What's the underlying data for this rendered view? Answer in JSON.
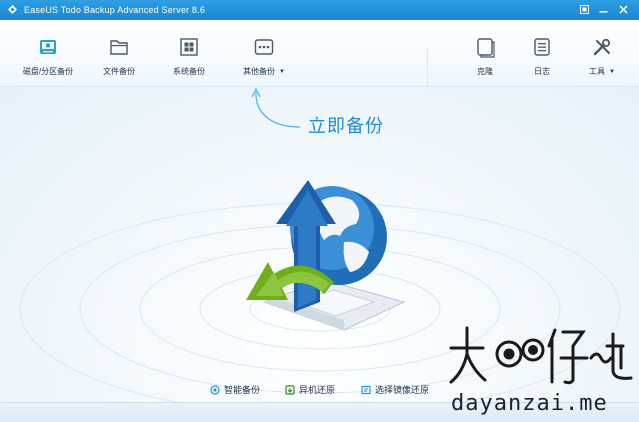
{
  "window": {
    "title": "EaseUS Todo Backup Advanced Server 8.6"
  },
  "toolbar": {
    "left_tools": [
      {
        "label": "磁盘/分区备份",
        "icon": "disk-partition-icon"
      },
      {
        "label": "文件备份",
        "icon": "folder-icon"
      },
      {
        "label": "系统备份",
        "icon": "windows-system-icon"
      },
      {
        "label": "其他备份",
        "icon": "more-dots-icon",
        "has_dropdown": true
      }
    ],
    "right_tools": [
      {
        "label": "克隆",
        "icon": "clone-icon"
      },
      {
        "label": "日志",
        "icon": "log-icon"
      },
      {
        "label": "工具",
        "icon": "tools-icon",
        "has_dropdown": true
      }
    ]
  },
  "main": {
    "backup_now_label": "立即备份",
    "hero_icon": "globe-backup-arrows-icon"
  },
  "bottom_actions": [
    {
      "label": "智能备份",
      "icon": "smart-backup-icon"
    },
    {
      "label": "异机还原",
      "icon": "restore-other-machine-icon"
    },
    {
      "label": "选择镜像还原",
      "icon": "browse-image-restore-icon"
    }
  ],
  "watermark": {
    "text": "大眼仔~旭",
    "url": "dayanzai.me"
  },
  "colors": {
    "accent": "#1f8cd8",
    "titlebar": "#1b86d2",
    "toolbar_text": "#1f3247"
  }
}
